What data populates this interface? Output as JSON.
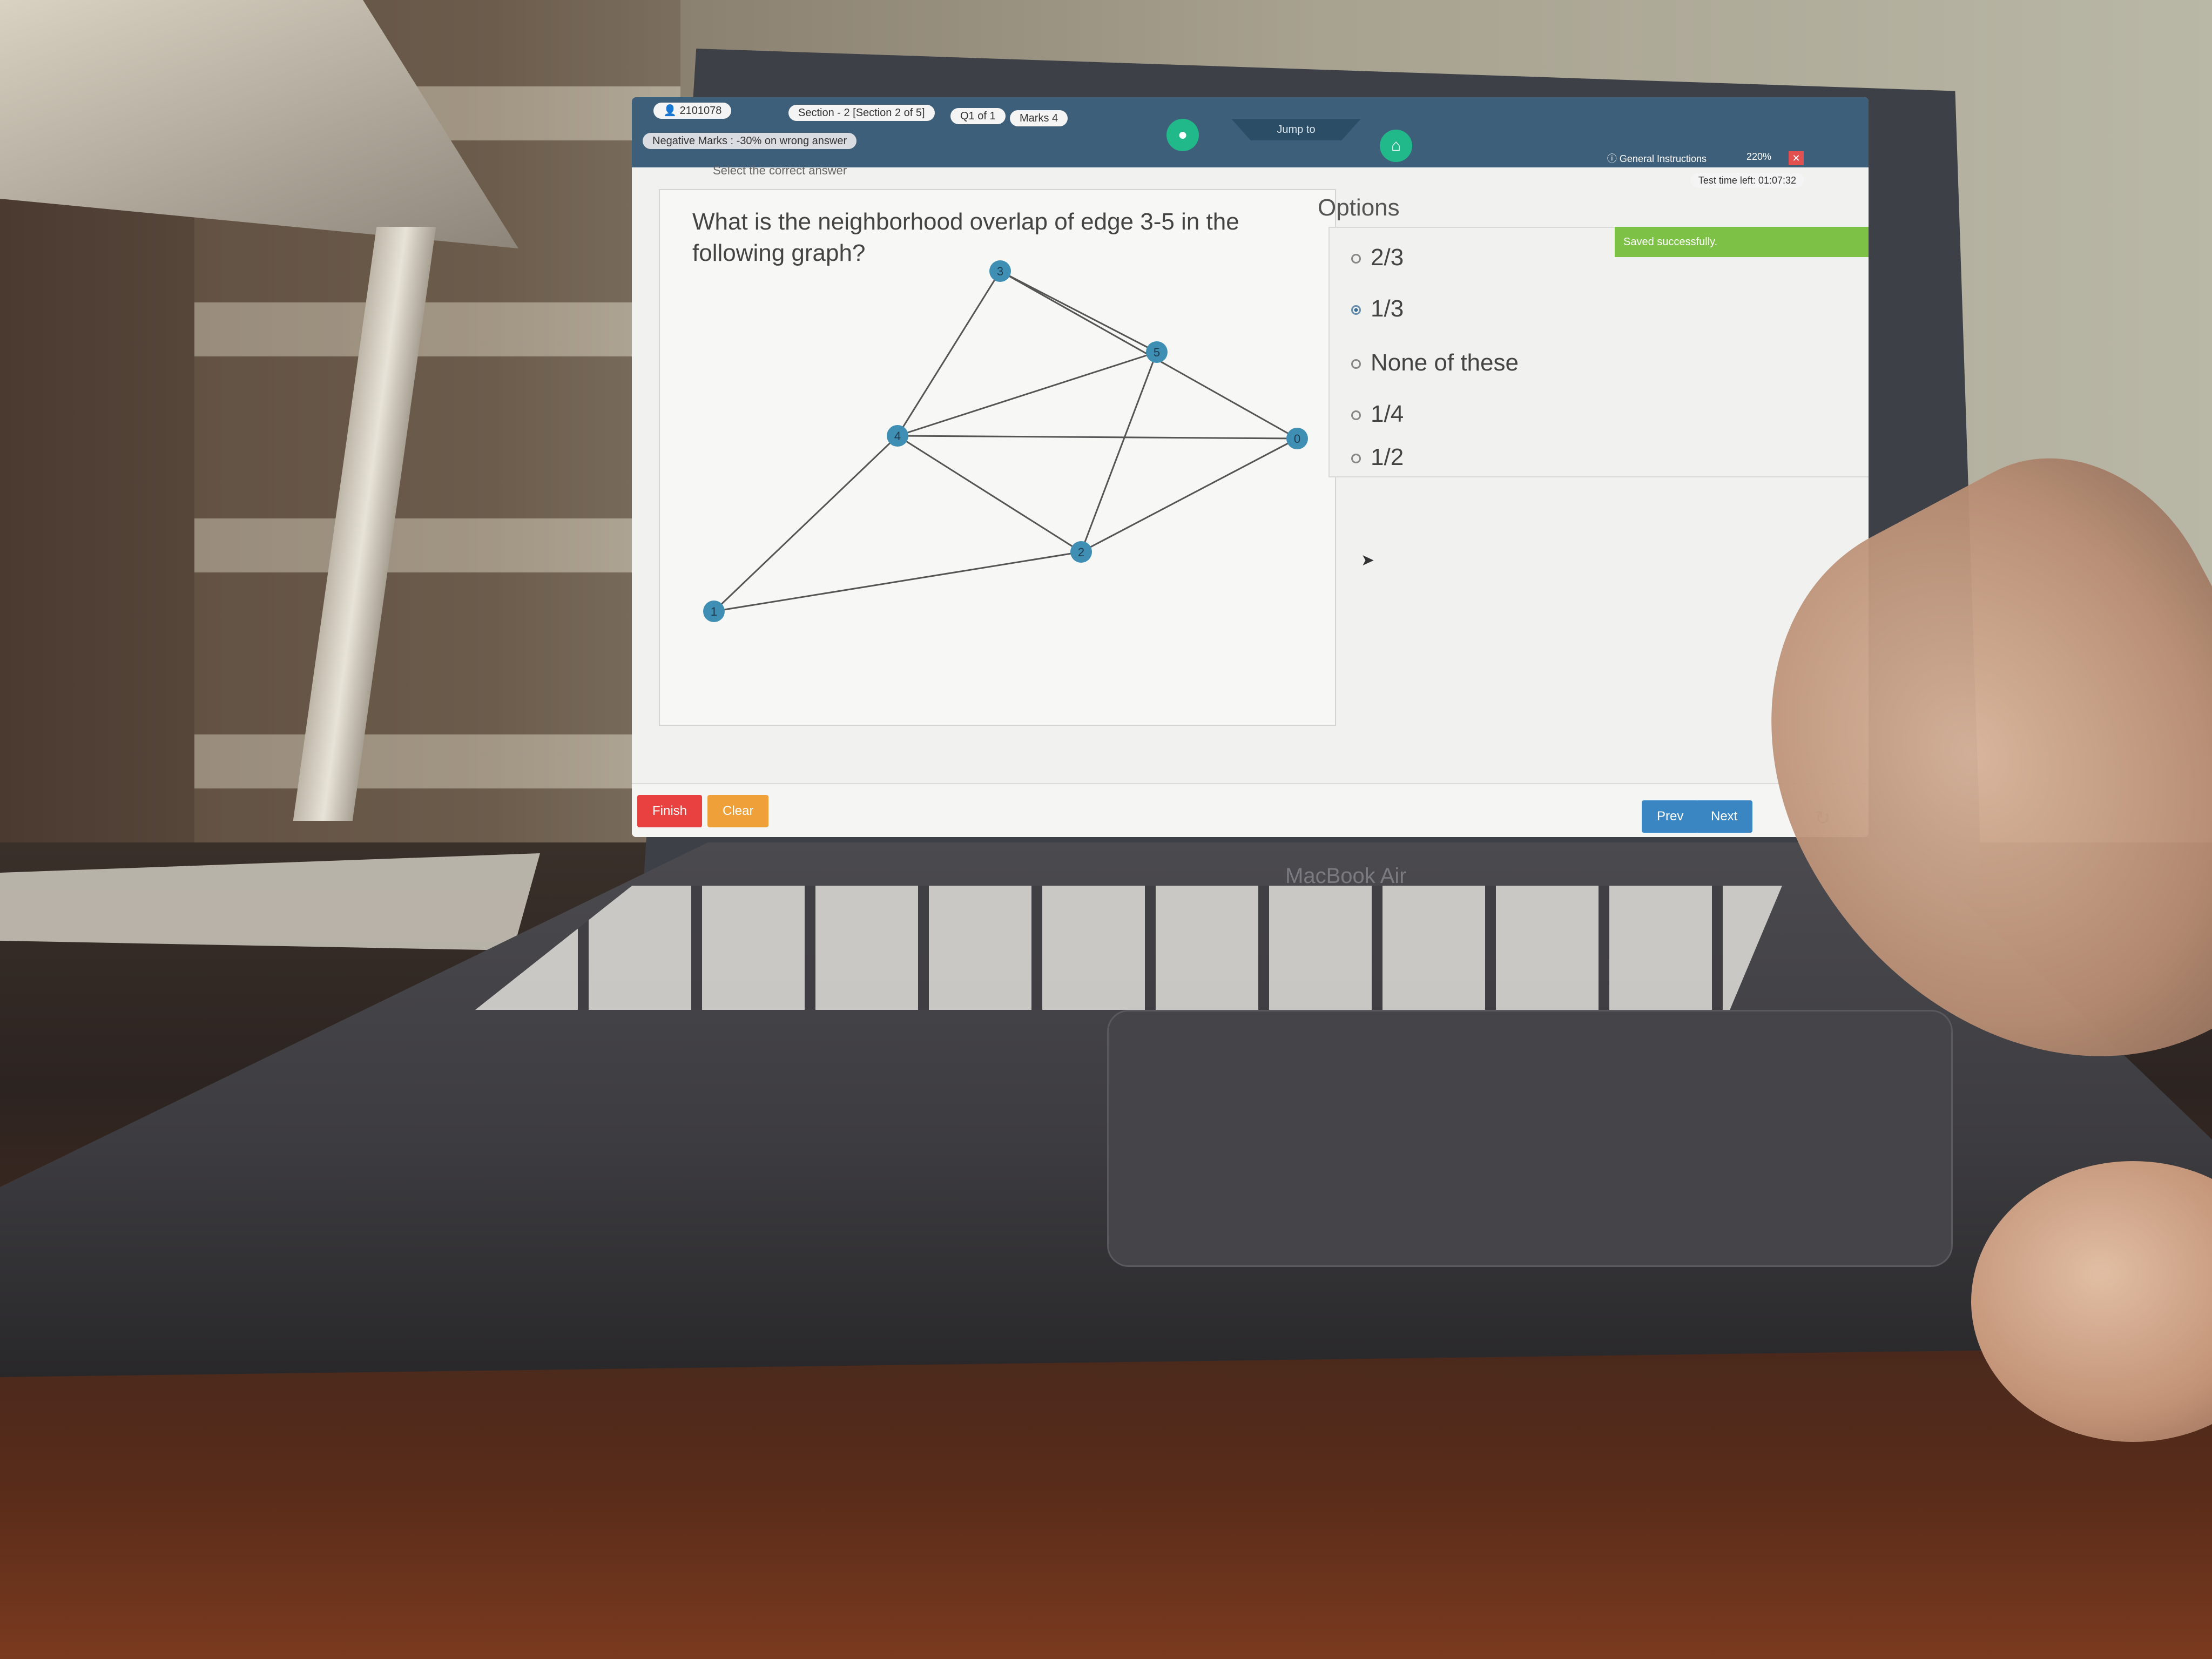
{
  "header": {
    "candidate_id": "2101078",
    "section": "Section - 2 [Section 2 of 5]",
    "question_counter": "Q1 of 1",
    "marks": "Marks 4",
    "negative_marks": "Negative Marks : -30% on wrong answer",
    "jump_to": "Jump to",
    "general_instructions": "General Instructions",
    "zoom": "220%",
    "time_left": "Test time left: 01:07:32"
  },
  "question": {
    "instruction": "Select the correct answer",
    "text": "What is the neighborhood overlap of edge 3-5 in the following graph?"
  },
  "graph": {
    "nodes": [
      "0",
      "1",
      "2",
      "3",
      "4",
      "5"
    ],
    "edges": [
      [
        "3",
        "4"
      ],
      [
        "3",
        "5"
      ],
      [
        "3",
        "0"
      ],
      [
        "4",
        "5"
      ],
      [
        "4",
        "0"
      ],
      [
        "4",
        "2"
      ],
      [
        "4",
        "1"
      ],
      [
        "5",
        "2"
      ],
      [
        "0",
        "2"
      ],
      [
        "1",
        "2"
      ]
    ]
  },
  "options_panel": {
    "title": "Options",
    "saved_message": "Saved successfully.",
    "options": [
      {
        "label": "2/3",
        "selected": false
      },
      {
        "label": "1/3",
        "selected": true
      },
      {
        "label": "None of these",
        "selected": false
      },
      {
        "label": "1/4",
        "selected": false
      },
      {
        "label": "1/2",
        "selected": false
      }
    ]
  },
  "footer": {
    "finish": "Finish",
    "clear": "Clear",
    "prev": "Prev",
    "next": "Next"
  },
  "laptop": {
    "brand": "MacBook Air"
  },
  "colors": {
    "topbar": "#3e5f7a",
    "accent_green": "#22b890",
    "finish_red": "#e9413f",
    "clear_orange": "#f0a038",
    "nav_blue": "#3a86c3",
    "saved_green": "#7dc147",
    "node_blue": "#3f8fb5"
  }
}
